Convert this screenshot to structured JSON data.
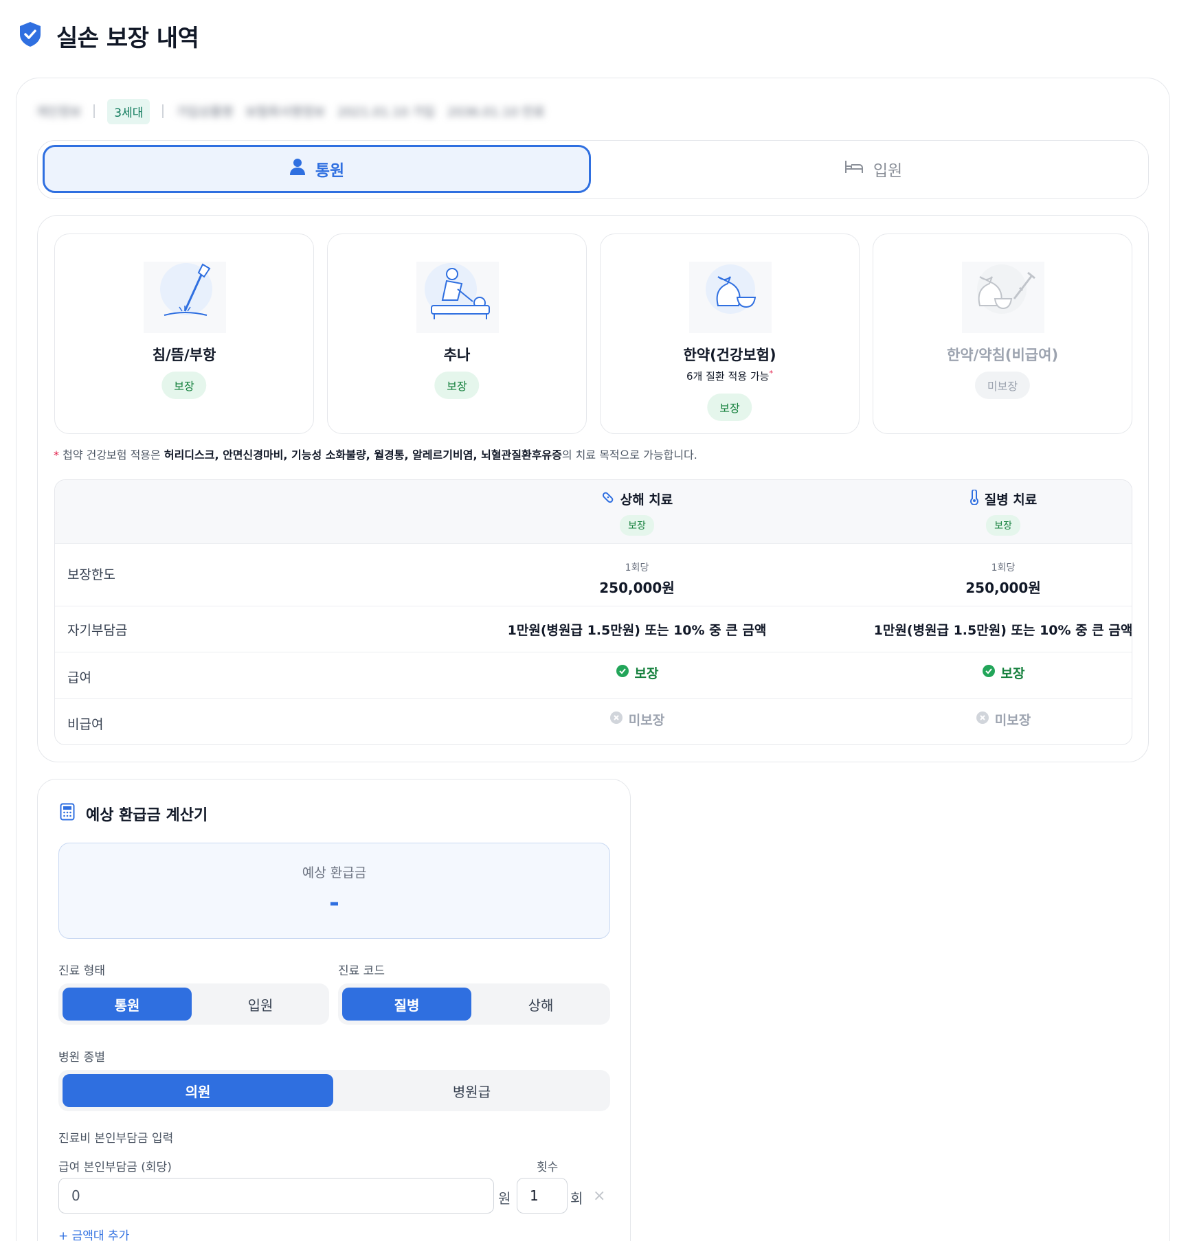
{
  "header": {
    "title": "실손 보장 내역",
    "brand_color": "#2f6fe0"
  },
  "meta": {
    "blurred_1": "개인정보",
    "generation": "3세대",
    "blurred_2": "가입상품명",
    "blurred_3": "보험회사명정보",
    "blurred_4": "2021.01.10 가입",
    "blurred_5": "2036.01.10 만료"
  },
  "tabs": [
    {
      "label": "통원",
      "icon": "user-icon",
      "active": true
    },
    {
      "label": "입원",
      "icon": "bed-icon",
      "active": false
    }
  ],
  "categories": [
    {
      "title": "침/뜸/부항",
      "subtitle": "",
      "status": "보장",
      "covered": true,
      "icon": "acupuncture-icon"
    },
    {
      "title": "추나",
      "subtitle": "",
      "status": "보장",
      "covered": true,
      "icon": "chuna-icon"
    },
    {
      "title": "한약(건강보험)",
      "subtitle": "6개 질환 적용 가능",
      "subtitle_mark": "*",
      "status": "보장",
      "covered": true,
      "icon": "herbal-medicine-icon"
    },
    {
      "title": "한약/약침(비급여)",
      "subtitle": "",
      "status": "미보장",
      "covered": false,
      "icon": "herbal-injection-icon"
    }
  ],
  "note": {
    "mark": "*",
    "prefix": "첩약 건강보험 적용은 ",
    "diseases": "허리디스크, 안면신경마비, 기능성 소화불량, 월경통, 알레르기비염, 뇌혈관질환후유증",
    "suffix": "의 치료 목적으로 가능합니다."
  },
  "coverage_table": {
    "columns": [
      {
        "title": "상해 치료",
        "badge": "보장",
        "icon": "bandage-icon"
      },
      {
        "title": "질병 치료",
        "badge": "보장",
        "icon": "thermometer-icon"
      }
    ],
    "rows": {
      "limit": {
        "label": "보장한도",
        "per": "1회당",
        "values": [
          "250,000원",
          "250,000원"
        ]
      },
      "deductible": {
        "label": "자기부담금",
        "values": [
          "1만원(병원급 1.5만원) 또는 10% 중 큰 금액",
          "1만원(병원급 1.5만원) 또는 10% 중 큰 금액"
        ]
      },
      "covered": {
        "label": "급여",
        "values": [
          "보장",
          "보장"
        ]
      },
      "noncovered": {
        "label": "비급여",
        "values": [
          "미보장",
          "미보장"
        ]
      }
    }
  },
  "calculator": {
    "title": "예상 환급금 계산기",
    "refund_label": "예상 환급금",
    "refund_value": "-",
    "treatment_type": {
      "label": "진료 형태",
      "options": [
        "통원",
        "입원"
      ],
      "selected": "통원"
    },
    "treatment_code": {
      "label": "진료 코드",
      "options": [
        "질병",
        "상해"
      ],
      "selected": "질병"
    },
    "hospital_type": {
      "label": "병원 종별",
      "options": [
        "의원",
        "병원급"
      ],
      "selected": "의원"
    },
    "input_section": "진료비 본인부담금 입력",
    "copay_label": "급여 본인부담금 (회당)",
    "copay_value": "0",
    "copay_unit": "원",
    "count_label": "횟수",
    "count_value": "1",
    "count_unit": "회",
    "remove_symbol": "×",
    "add_label": "+ 금액대 추가"
  }
}
